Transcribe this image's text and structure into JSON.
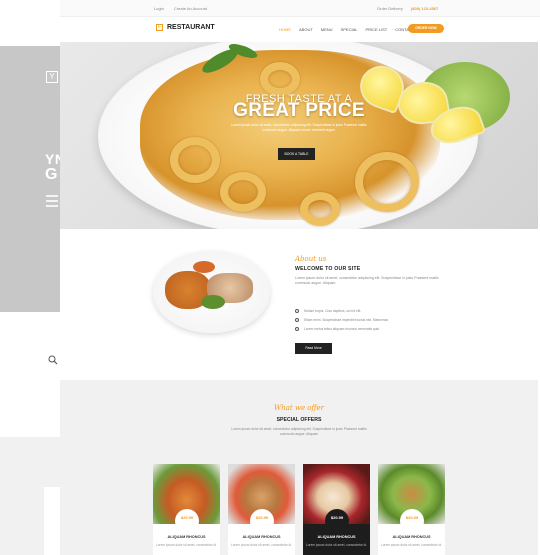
{
  "topbar": {
    "login": "Login",
    "create_account": "Create An Account",
    "order_label": "Order Delivery",
    "phone": "(800) 123-4567"
  },
  "header": {
    "logo_mark": "F",
    "logo_text": "RESTAURANT",
    "nav": [
      "HOME",
      "ABOUT",
      "MENU",
      "SPECIAL",
      "PRICE LIST",
      "CONTACT"
    ],
    "order_button": "ORDER NOW"
  },
  "left_slide": {
    "badge": "Y",
    "line1": "YN",
    "line2": "G"
  },
  "hero": {
    "title_line1": "FRESH TASTE AT A",
    "title_line2": "GREAT PRICE",
    "subtitle": "Lorem ipsum dolor sit amet, consectetur adipiscing elit. Suspendisse in justo Praesent mattis commodo augue. Aliquam ornare hendrerit augue.",
    "button": "BOOK A TABLE"
  },
  "welcome": {
    "script": "About us",
    "title": "WELCOME TO OUR SITE",
    "text": "Lorem ipsum dolor sit amet, consectetur adipiscing elit. Suspendisse in justo Praesent mattis commodo augue. Aliquam",
    "checks": [
      "Nullam turpis. Cras dapibus, orci id elit.",
      "Etiam enim. Suspendisse imperdiet luctus nisl. Maecenas",
      "Lorem metus tellus aliquam rhoncus venenatis quis."
    ],
    "button": "Read More"
  },
  "offers": {
    "script": "What we offer",
    "title": "SPECIAL OFFERS",
    "text": "Lorem ipsum dolor sit amet, consectetur adipiscing elit. Suspendisse in justo Praesent mattis commodo augue. Aliquam",
    "cards": [
      {
        "price": "$20.99",
        "name": "ALIQUAM RHONCUS",
        "desc": "Lorem ipsum dolor sit amet, consectetur id."
      },
      {
        "price": "$20.99",
        "name": "ALIQUAM RHONCUS",
        "desc": "Lorem ipsum dolor sit amet, consectetur id."
      },
      {
        "price": "$20.99",
        "name": "ALIQUAM RHONCUS",
        "desc": "Lorem ipsum dolor sit amet, consectetur id."
      },
      {
        "price": "$20.99",
        "name": "ALIQUAM RHONCUS",
        "desc": "Lorem ipsum dolor sit amet, consectetur id."
      }
    ]
  },
  "colors": {
    "accent": "#f29c1f",
    "dark": "#1d1d1d"
  }
}
